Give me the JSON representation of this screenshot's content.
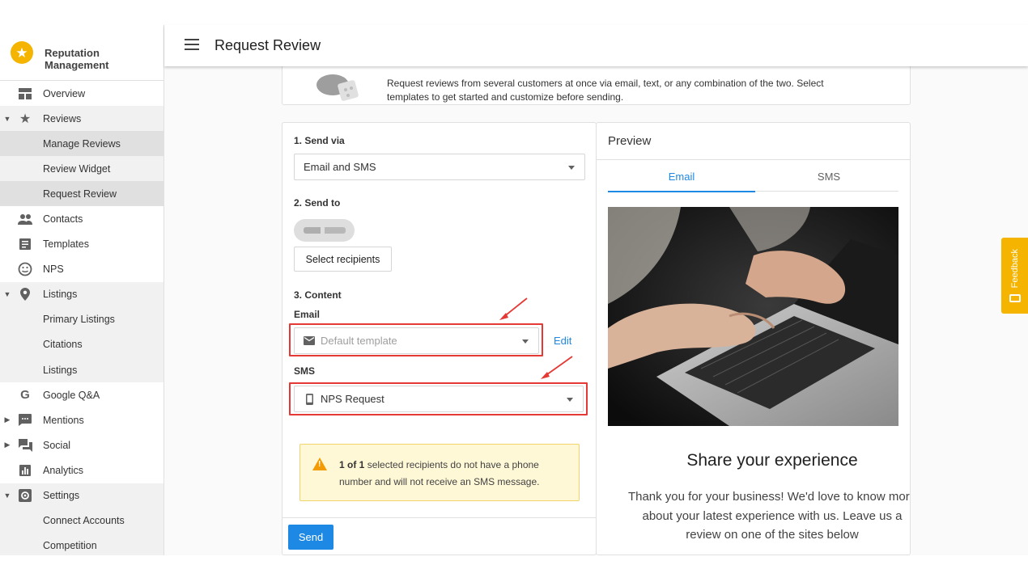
{
  "app": {
    "brand_name": "Reputation Management",
    "page_title": "Request Review"
  },
  "sidebar": {
    "items": [
      {
        "label": "Overview",
        "icon": "dashboard-icon"
      },
      {
        "label": "Reviews",
        "icon": "star-icon"
      },
      {
        "label": "Manage Reviews"
      },
      {
        "label": "Review Widget"
      },
      {
        "label": "Request Review"
      },
      {
        "label": "Contacts",
        "icon": "people-icon"
      },
      {
        "label": "Templates",
        "icon": "template-icon"
      },
      {
        "label": "NPS",
        "icon": "smiley-icon"
      },
      {
        "label": "Listings",
        "icon": "location-icon"
      },
      {
        "label": "Primary Listings"
      },
      {
        "label": "Citations"
      },
      {
        "label": "Listings"
      },
      {
        "label": "Google Q&A",
        "icon": "google-icon"
      },
      {
        "label": "Mentions",
        "icon": "comment-icon"
      },
      {
        "label": "Social",
        "icon": "forum-icon"
      },
      {
        "label": "Analytics",
        "icon": "bar-chart-icon"
      },
      {
        "label": "Settings",
        "icon": "gear-icon"
      },
      {
        "label": "Connect Accounts"
      },
      {
        "label": "Competition"
      }
    ]
  },
  "intro": {
    "text": "Request reviews from several customers at once via email, text, or any combination of the two. Select templates to get started and customize before sending."
  },
  "form": {
    "send_via_label": "1. Send via",
    "send_via_value": "Email and SMS",
    "send_to_label": "2. Send to",
    "select_recipients_button": "Select recipients",
    "content_label": "3. Content",
    "email_label": "Email",
    "email_template_placeholder": "Default template",
    "edit_link": "Edit",
    "sms_label": "SMS",
    "sms_template_value": "NPS Request",
    "warning_count": "1 of 1",
    "warning_text": "selected recipients do not have a phone number and will not receive an SMS message.",
    "send_button": "Send"
  },
  "preview": {
    "title": "Preview",
    "tabs": [
      "Email",
      "SMS"
    ],
    "active_tab": "Email",
    "headline": "Share your experience",
    "body": "Thank you for your business! We'd love to know more about your latest experience with us. Leave us a review on one of the sites below"
  },
  "feedback": {
    "label": "Feedback"
  },
  "colors": {
    "brand": "#f4b400",
    "accent": "#1e88e5",
    "highlight": "#e53935",
    "warning_bg": "#fff8d6",
    "warning_icon": "#f29b05"
  }
}
